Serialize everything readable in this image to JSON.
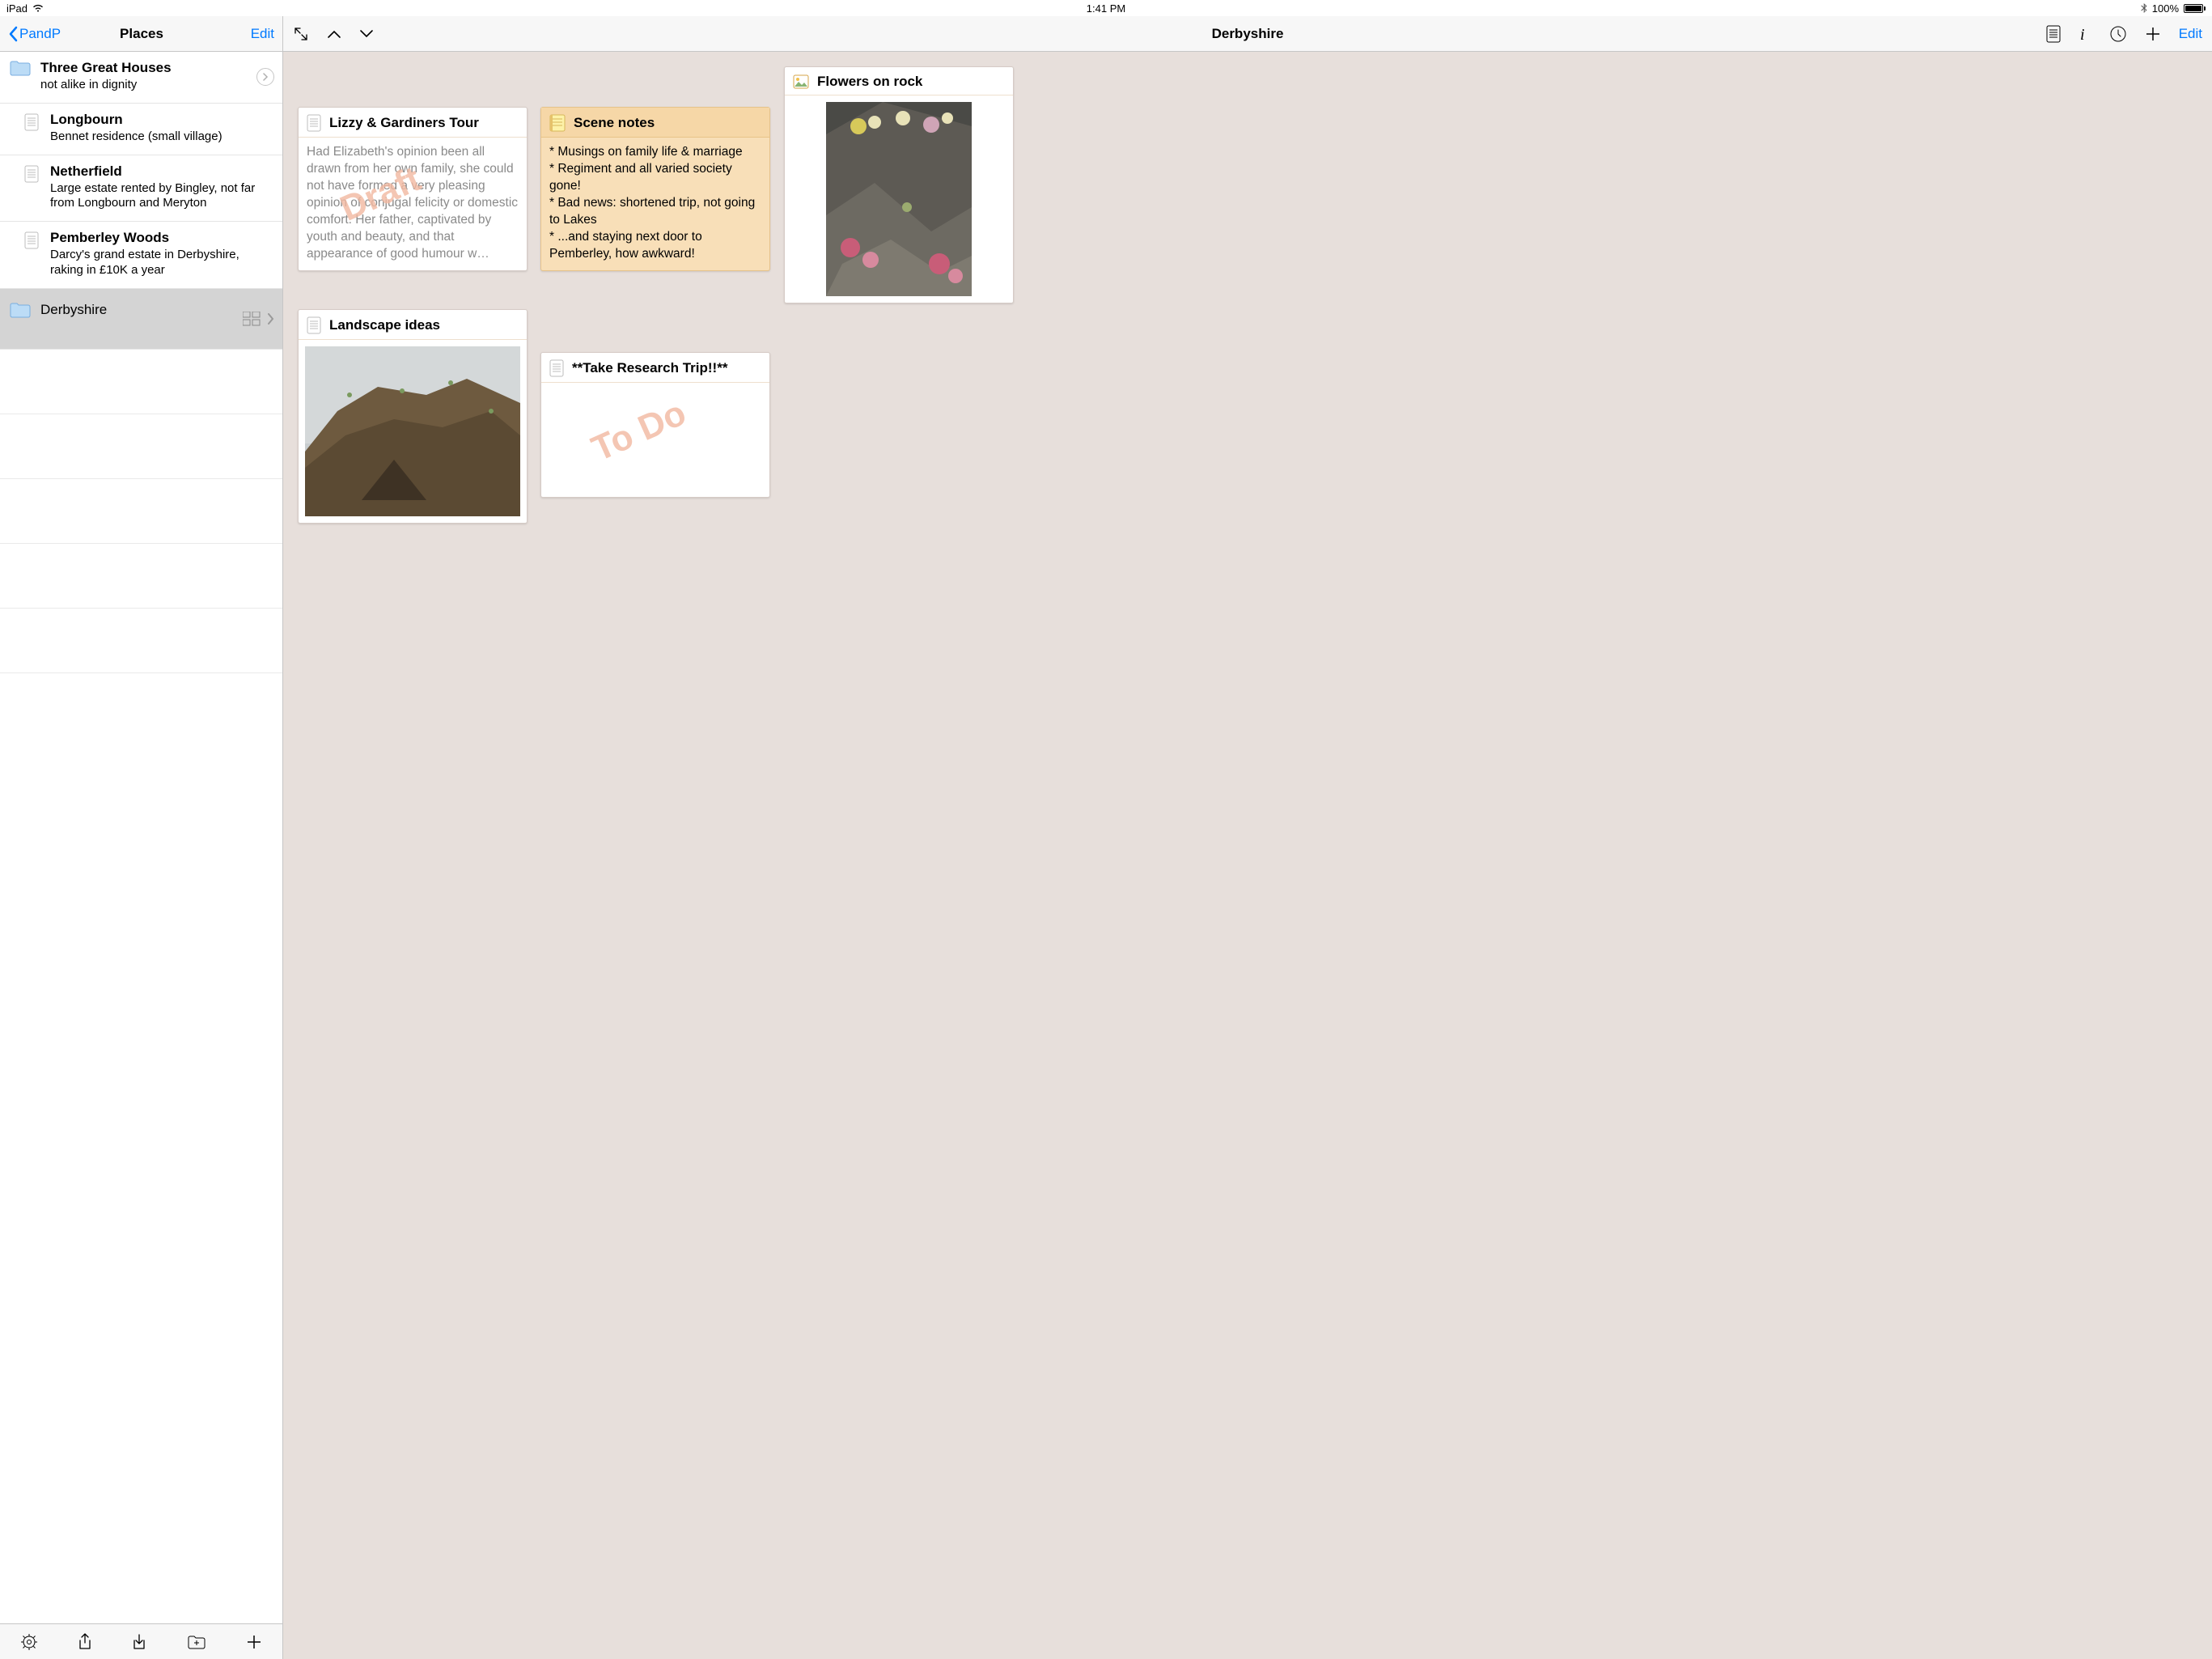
{
  "statusbar": {
    "device": "iPad",
    "time": "1:41 PM",
    "battery": "100%"
  },
  "sidebar": {
    "back_label": "PandP",
    "title": "Places",
    "edit_label": "Edit",
    "folder_top": {
      "title": "Three Great Houses",
      "subtitle": "not alike in dignity"
    },
    "docs": [
      {
        "title": "Longbourn",
        "subtitle": "Bennet residence (small village)"
      },
      {
        "title": "Netherfield",
        "subtitle": "Large estate rented by Bingley, not far from Longbourn and Meryton"
      },
      {
        "title": "Pemberley Woods",
        "subtitle": "Darcy's grand estate in Derbyshire, raking in £10K a year"
      }
    ],
    "selected": {
      "title": "Derbyshire"
    }
  },
  "main": {
    "title": "Derbyshire",
    "edit_label": "Edit"
  },
  "cards": {
    "lizzy": {
      "title": "Lizzy & Gardiners Tour",
      "body": "Had Elizabeth's opinion been all drawn from her own family, she could not have formed a very pleasing opinion of conjugal felicity or domestic comfort. Her father, captivated by youth and beauty, and that appearance of good humour w…",
      "watermark": "Draft"
    },
    "scene": {
      "title": "Scene notes",
      "lines": [
        "* Musings on family life & marriage",
        "* Regiment and all varied society gone!",
        "* Bad news: shortened trip, not going to Lakes",
        "* ...and staying next door to Pemberley, how awkward!"
      ]
    },
    "flowers": {
      "title": "Flowers on rock"
    },
    "landscape": {
      "title": "Landscape ideas"
    },
    "research": {
      "title": "**Take Research Trip!!**",
      "watermark": "To Do"
    }
  }
}
